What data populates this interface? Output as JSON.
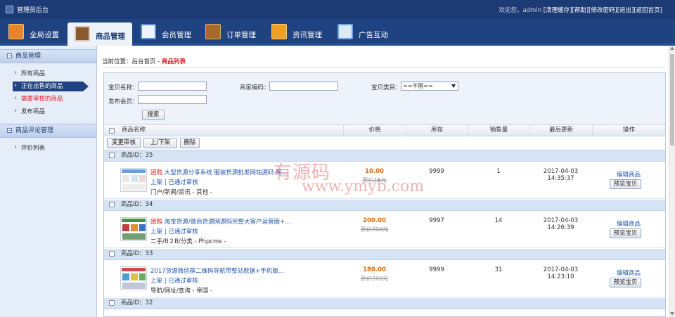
{
  "header": {
    "title": "管理员后台",
    "welcome": "欢迎您，admin",
    "links": [
      "[清理缓存]",
      "[帮助]",
      "[修改密码]",
      "[退出]",
      "[返回首页]"
    ]
  },
  "nav": {
    "tabs": [
      {
        "label": "全局设置",
        "icon": "building-icon",
        "color": "#e8842a"
      },
      {
        "label": "商品管理",
        "icon": "grid-icon",
        "color": "#8a5a2e",
        "active": true
      },
      {
        "label": "会员管理",
        "icon": "id-card-icon",
        "color": "#5b8fd0"
      },
      {
        "label": "订单管理",
        "icon": "wallet-icon",
        "color": "#a86a2a"
      },
      {
        "label": "资讯管理",
        "icon": "news-icon",
        "color": "#f0a020"
      },
      {
        "label": "广告互动",
        "icon": "list-icon",
        "color": "#6fa4e0"
      }
    ]
  },
  "sidebar": {
    "groups": [
      {
        "title": "商品管理",
        "items": [
          {
            "label": "所有商品"
          },
          {
            "label": "正在出售的商品",
            "active": true
          },
          {
            "label": "需要审核的商品",
            "highlight": true
          },
          {
            "label": "发布商品"
          }
        ]
      },
      {
        "title": "商品评论管理",
        "items": [
          {
            "label": "评价列表"
          }
        ]
      }
    ]
  },
  "breadcrumb": {
    "prefix": "当前位置：后台首页 - ",
    "current": "商品列表"
  },
  "search": {
    "name_label": "宝贝名称：",
    "seller_code_label": "商家编码：",
    "category_label": "宝贝类目：",
    "category_value": "==不限==",
    "member_label": "发布会员：",
    "search_button": "搜索"
  },
  "table": {
    "columns": [
      "商品名称",
      "价格",
      "库存",
      "销售量",
      "最后更新",
      "操作"
    ],
    "actions": [
      "变更审核",
      "上/下架",
      "删除"
    ],
    "rows": [
      {
        "id": "商品ID：35",
        "tag": "团购",
        "title": "大型货源分享系统 服装货源批发网站源码 阿...",
        "status": "上架 | 已通过审核",
        "category": "门户/新闻/资讯 - 其他 -",
        "price": "10.00",
        "orig_price": "原价15元",
        "stock": "9999",
        "sales": "1",
        "updated": "2017-04-03 14:35:37",
        "edit": "编辑商品",
        "preview": "预览宝贝"
      },
      {
        "id": "商品ID：34",
        "tag": "团购",
        "title": "淘宝货源/微商货源网源码完整大客户运营版+...",
        "status": "上架 | 已通过审核",
        "category": "二手/B２B/分类 - Phpcms -",
        "price": "200.00",
        "orig_price": "原价300元",
        "stock": "9997",
        "sales": "14",
        "updated": "2017-04-03 14:26:39",
        "edit": "编辑商品",
        "preview": "预览宝贝"
      },
      {
        "id": "商品ID：33",
        "tag": "",
        "title": "2017货源微信群二维码导航带整站数据+手机版...",
        "status": "上架 | 已通过审核",
        "category": "导航/网址/查询 - 帝国 -",
        "price": "180.00",
        "orig_price": "原价200元",
        "stock": "9999",
        "sales": "31",
        "updated": "2017-04-03 14:23:10",
        "edit": "编辑商品",
        "preview": "预览宝贝"
      }
    ],
    "next_row_id": "商品ID：32"
  },
  "watermark": {
    "line1": "有源码",
    "line2": "www.ymyb.com"
  }
}
